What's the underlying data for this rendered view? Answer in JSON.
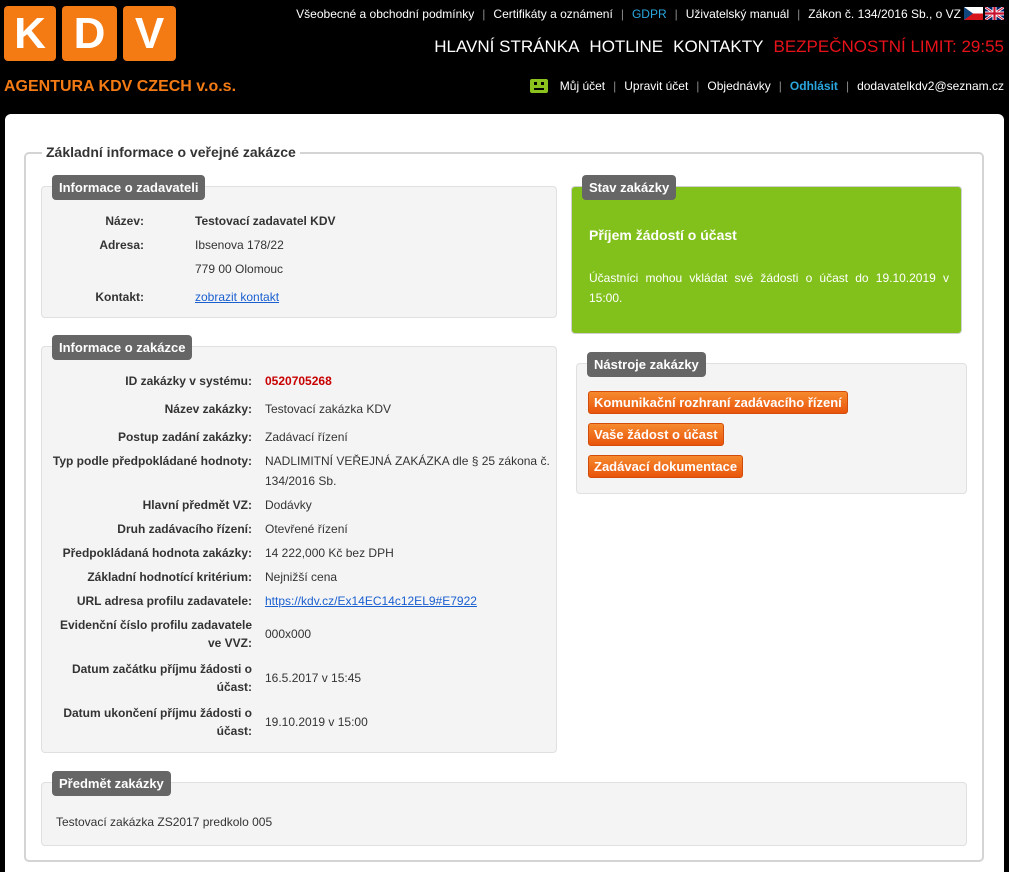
{
  "logo": {
    "letters": [
      "K",
      "D",
      "V"
    ]
  },
  "topmenu": [
    {
      "label": "Všeobecné a obchodní podmínky",
      "name": "terms"
    },
    {
      "label": "Certifikáty a oznámení",
      "name": "certificates"
    },
    {
      "label": "GDPR",
      "name": "gdpr"
    },
    {
      "label": "Uživatelský manuál",
      "name": "manual"
    },
    {
      "label": "Zákon č. 134/2016 Sb., o VZ",
      "name": "law"
    }
  ],
  "mainnav": {
    "home": "HLAVNÍ STRÁNKA",
    "hotline": "HOTLINE",
    "contacts": "KONTAKTY",
    "security_limit": "BEZPEČNOSTNÍ LIMIT: 29:55"
  },
  "agency": "AGENTURA KDV CZECH v.o.s.",
  "usermenu": {
    "account": "Můj účet",
    "edit_account": "Upravit účet",
    "orders": "Objednávky",
    "logout": "Odhlásit",
    "email": "dodavatelkdv2@seznam.cz"
  },
  "legend": "Základní informace o veřejné zakázce",
  "contracting_authority": {
    "title": "Informace o zadavateli",
    "name_label": "Název:",
    "name_value": "Testovací zadavatel KDV",
    "address_label": "Adresa:",
    "address_line1": "Ibsenova 178/22",
    "address_line2": "779 00 Olomouc",
    "contact_label": "Kontakt:",
    "contact_link": "zobrazit kontakt"
  },
  "contract": {
    "title": "Informace o zakázce",
    "rows": [
      {
        "label": "ID zakázky v systému:",
        "value": "0520705268"
      },
      {
        "label": "Název zakázky:",
        "value": "Testovací zakázka KDV"
      },
      {
        "label": "Postup zadání zakázky:",
        "value": "Zadávací řízení"
      },
      {
        "label": "Typ podle předpokládané hodnoty:",
        "value": "NADLIMITNÍ VEŘEJNÁ ZAKÁZKA dle § 25 zákona č. 134/2016 Sb."
      },
      {
        "label": "Hlavní předmět VZ:",
        "value": "Dodávky"
      },
      {
        "label": "Druh zadávacího řízení:",
        "value": "Otevřené řízení"
      },
      {
        "label": "Předpokládaná hodnota zakázky:",
        "value": "14 222,000 Kč bez DPH"
      },
      {
        "label": "Základní hodnotící kritérium:",
        "value": "Nejnižší cena"
      },
      {
        "label": "URL adresa profilu zadavatele:",
        "value": "https://kdv.cz/Ex14EC14c12EL9#E7922"
      },
      {
        "label": "Evidenční číslo profilu zadavatele ve VVZ:",
        "value": "000x000"
      },
      {
        "label": "Datum začátku příjmu žádosti o účast:",
        "value": "16.5.2017 v 15:45"
      },
      {
        "label": "Datum ukončení příjmu žádosti o účast:",
        "value": "19.10.2019 v 15:00"
      }
    ]
  },
  "status": {
    "title": "Stav zakázky",
    "heading": "Příjem žádostí o účast",
    "text": "Účastníci mohou vkládat své žádosti o účast do 19.10.2019 v 15:00."
  },
  "tools": {
    "title": "Nástroje zakázky",
    "buttons": [
      "Komunikační rozhraní zadávacího řízení",
      "Vaše žádost o účast",
      "Zadávací dokumentace"
    ]
  },
  "subject": {
    "title": "Předmět zakázky",
    "text": "Testovací zakázka ZS2017 predkolo 005"
  },
  "colors": {
    "accent": "#f47b14",
    "status_green": "#82c11c",
    "limit_red": "#e8121a",
    "link_blue": "#2aa7e0"
  }
}
